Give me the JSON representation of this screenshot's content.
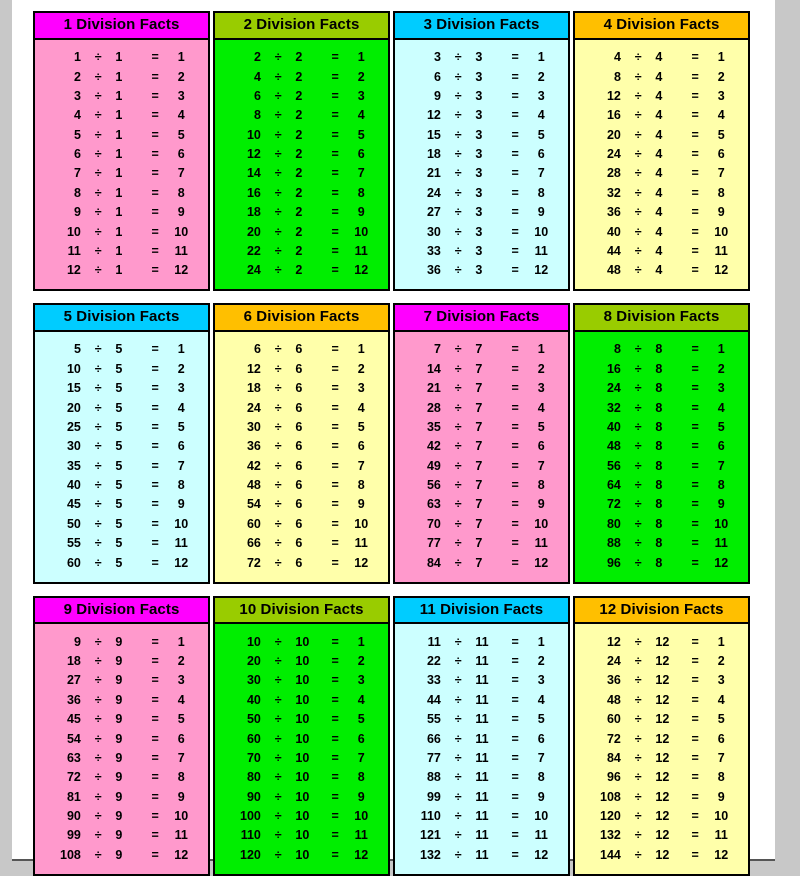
{
  "page": {
    "title": "Division Facts Tables",
    "background_color": "#ffffff",
    "outer_background_color": "#c8c8c8"
  },
  "palette": {
    "magenta_header": "#ff00ff",
    "pink_body": "#ff99cc",
    "olive_header": "#99cc00",
    "green_body": "#00ee00",
    "cyan_header": "#00ccff",
    "light_cyan_body": "#ccffff",
    "orange_header": "#ffbf00",
    "light_yellow_body": "#ffffaa",
    "border": "#000000",
    "text": "#000000"
  },
  "symbols": {
    "divide": "÷",
    "equals": "="
  },
  "cards": [
    {
      "title": "1 Division Facts",
      "header_color": "#ff00ff",
      "body_color": "#ff99cc",
      "header_class": "hdr-magenta",
      "body_class": "bdy-pink",
      "rows": [
        {
          "dividend": "1",
          "divisor": "1",
          "quotient": "1"
        },
        {
          "dividend": "2",
          "divisor": "1",
          "quotient": "2"
        },
        {
          "dividend": "3",
          "divisor": "1",
          "quotient": "3"
        },
        {
          "dividend": "4",
          "divisor": "1",
          "quotient": "4"
        },
        {
          "dividend": "5",
          "divisor": "1",
          "quotient": "5"
        },
        {
          "dividend": "6",
          "divisor": "1",
          "quotient": "6"
        },
        {
          "dividend": "7",
          "divisor": "1",
          "quotient": "7"
        },
        {
          "dividend": "8",
          "divisor": "1",
          "quotient": "8"
        },
        {
          "dividend": "9",
          "divisor": "1",
          "quotient": "9"
        },
        {
          "dividend": "10",
          "divisor": "1",
          "quotient": "10"
        },
        {
          "dividend": "11",
          "divisor": "1",
          "quotient": "11"
        },
        {
          "dividend": "12",
          "divisor": "1",
          "quotient": "12"
        }
      ]
    },
    {
      "title": "2 Division Facts",
      "header_color": "#99cc00",
      "body_color": "#00ee00",
      "header_class": "hdr-olive",
      "body_class": "bdy-green",
      "rows": [
        {
          "dividend": "2",
          "divisor": "2",
          "quotient": "1"
        },
        {
          "dividend": "4",
          "divisor": "2",
          "quotient": "2"
        },
        {
          "dividend": "6",
          "divisor": "2",
          "quotient": "3"
        },
        {
          "dividend": "8",
          "divisor": "2",
          "quotient": "4"
        },
        {
          "dividend": "10",
          "divisor": "2",
          "quotient": "5"
        },
        {
          "dividend": "12",
          "divisor": "2",
          "quotient": "6"
        },
        {
          "dividend": "14",
          "divisor": "2",
          "quotient": "7"
        },
        {
          "dividend": "16",
          "divisor": "2",
          "quotient": "8"
        },
        {
          "dividend": "18",
          "divisor": "2",
          "quotient": "9"
        },
        {
          "dividend": "20",
          "divisor": "2",
          "quotient": "10"
        },
        {
          "dividend": "22",
          "divisor": "2",
          "quotient": "11"
        },
        {
          "dividend": "24",
          "divisor": "2",
          "quotient": "12"
        }
      ]
    },
    {
      "title": "3 Division Facts",
      "header_color": "#00ccff",
      "body_color": "#ccffff",
      "header_class": "hdr-cyan",
      "body_class": "bdy-ltcyan",
      "rows": [
        {
          "dividend": "3",
          "divisor": "3",
          "quotient": "1"
        },
        {
          "dividend": "6",
          "divisor": "3",
          "quotient": "2"
        },
        {
          "dividend": "9",
          "divisor": "3",
          "quotient": "3"
        },
        {
          "dividend": "12",
          "divisor": "3",
          "quotient": "4"
        },
        {
          "dividend": "15",
          "divisor": "3",
          "quotient": "5"
        },
        {
          "dividend": "18",
          "divisor": "3",
          "quotient": "6"
        },
        {
          "dividend": "21",
          "divisor": "3",
          "quotient": "7"
        },
        {
          "dividend": "24",
          "divisor": "3",
          "quotient": "8"
        },
        {
          "dividend": "27",
          "divisor": "3",
          "quotient": "9"
        },
        {
          "dividend": "30",
          "divisor": "3",
          "quotient": "10"
        },
        {
          "dividend": "33",
          "divisor": "3",
          "quotient": "11"
        },
        {
          "dividend": "36",
          "divisor": "3",
          "quotient": "12"
        }
      ]
    },
    {
      "title": "4 Division Facts",
      "header_color": "#ffbf00",
      "body_color": "#ffffaa",
      "header_class": "hdr-orange",
      "body_class": "bdy-ltyellow",
      "rows": [
        {
          "dividend": "4",
          "divisor": "4",
          "quotient": "1"
        },
        {
          "dividend": "8",
          "divisor": "4",
          "quotient": "2"
        },
        {
          "dividend": "12",
          "divisor": "4",
          "quotient": "3"
        },
        {
          "dividend": "16",
          "divisor": "4",
          "quotient": "4"
        },
        {
          "dividend": "20",
          "divisor": "4",
          "quotient": "5"
        },
        {
          "dividend": "24",
          "divisor": "4",
          "quotient": "6"
        },
        {
          "dividend": "28",
          "divisor": "4",
          "quotient": "7"
        },
        {
          "dividend": "32",
          "divisor": "4",
          "quotient": "8"
        },
        {
          "dividend": "36",
          "divisor": "4",
          "quotient": "9"
        },
        {
          "dividend": "40",
          "divisor": "4",
          "quotient": "10"
        },
        {
          "dividend": "44",
          "divisor": "4",
          "quotient": "11"
        },
        {
          "dividend": "48",
          "divisor": "4",
          "quotient": "12"
        }
      ]
    },
    {
      "title": "5 Division Facts",
      "header_color": "#00ccff",
      "body_color": "#ccffff",
      "header_class": "hdr-cyan",
      "body_class": "bdy-ltcyan",
      "rows": [
        {
          "dividend": "5",
          "divisor": "5",
          "quotient": "1"
        },
        {
          "dividend": "10",
          "divisor": "5",
          "quotient": "2"
        },
        {
          "dividend": "15",
          "divisor": "5",
          "quotient": "3"
        },
        {
          "dividend": "20",
          "divisor": "5",
          "quotient": "4"
        },
        {
          "dividend": "25",
          "divisor": "5",
          "quotient": "5"
        },
        {
          "dividend": "30",
          "divisor": "5",
          "quotient": "6"
        },
        {
          "dividend": "35",
          "divisor": "5",
          "quotient": "7"
        },
        {
          "dividend": "40",
          "divisor": "5",
          "quotient": "8"
        },
        {
          "dividend": "45",
          "divisor": "5",
          "quotient": "9"
        },
        {
          "dividend": "50",
          "divisor": "5",
          "quotient": "10"
        },
        {
          "dividend": "55",
          "divisor": "5",
          "quotient": "11"
        },
        {
          "dividend": "60",
          "divisor": "5",
          "quotient": "12"
        }
      ]
    },
    {
      "title": "6 Division Facts",
      "header_color": "#ffbf00",
      "body_color": "#ffffaa",
      "header_class": "hdr-orange",
      "body_class": "bdy-ltyellow",
      "rows": [
        {
          "dividend": "6",
          "divisor": "6",
          "quotient": "1"
        },
        {
          "dividend": "12",
          "divisor": "6",
          "quotient": "2"
        },
        {
          "dividend": "18",
          "divisor": "6",
          "quotient": "3"
        },
        {
          "dividend": "24",
          "divisor": "6",
          "quotient": "4"
        },
        {
          "dividend": "30",
          "divisor": "6",
          "quotient": "5"
        },
        {
          "dividend": "36",
          "divisor": "6",
          "quotient": "6"
        },
        {
          "dividend": "42",
          "divisor": "6",
          "quotient": "7"
        },
        {
          "dividend": "48",
          "divisor": "6",
          "quotient": "8"
        },
        {
          "dividend": "54",
          "divisor": "6",
          "quotient": "9"
        },
        {
          "dividend": "60",
          "divisor": "6",
          "quotient": "10"
        },
        {
          "dividend": "66",
          "divisor": "6",
          "quotient": "11"
        },
        {
          "dividend": "72",
          "divisor": "6",
          "quotient": "12"
        }
      ]
    },
    {
      "title": "7 Division Facts",
      "header_color": "#ff00ff",
      "body_color": "#ff99cc",
      "header_class": "hdr-magenta",
      "body_class": "bdy-pink",
      "rows": [
        {
          "dividend": "7",
          "divisor": "7",
          "quotient": "1"
        },
        {
          "dividend": "14",
          "divisor": "7",
          "quotient": "2"
        },
        {
          "dividend": "21",
          "divisor": "7",
          "quotient": "3"
        },
        {
          "dividend": "28",
          "divisor": "7",
          "quotient": "4"
        },
        {
          "dividend": "35",
          "divisor": "7",
          "quotient": "5"
        },
        {
          "dividend": "42",
          "divisor": "7",
          "quotient": "6"
        },
        {
          "dividend": "49",
          "divisor": "7",
          "quotient": "7"
        },
        {
          "dividend": "56",
          "divisor": "7",
          "quotient": "8"
        },
        {
          "dividend": "63",
          "divisor": "7",
          "quotient": "9"
        },
        {
          "dividend": "70",
          "divisor": "7",
          "quotient": "10"
        },
        {
          "dividend": "77",
          "divisor": "7",
          "quotient": "11"
        },
        {
          "dividend": "84",
          "divisor": "7",
          "quotient": "12"
        }
      ]
    },
    {
      "title": "8 Division Facts",
      "header_color": "#99cc00",
      "body_color": "#00ee00",
      "header_class": "hdr-olive",
      "body_class": "bdy-green",
      "rows": [
        {
          "dividend": "8",
          "divisor": "8",
          "quotient": "1"
        },
        {
          "dividend": "16",
          "divisor": "8",
          "quotient": "2"
        },
        {
          "dividend": "24",
          "divisor": "8",
          "quotient": "3"
        },
        {
          "dividend": "32",
          "divisor": "8",
          "quotient": "4"
        },
        {
          "dividend": "40",
          "divisor": "8",
          "quotient": "5"
        },
        {
          "dividend": "48",
          "divisor": "8",
          "quotient": "6"
        },
        {
          "dividend": "56",
          "divisor": "8",
          "quotient": "7"
        },
        {
          "dividend": "64",
          "divisor": "8",
          "quotient": "8"
        },
        {
          "dividend": "72",
          "divisor": "8",
          "quotient": "9"
        },
        {
          "dividend": "80",
          "divisor": "8",
          "quotient": "10"
        },
        {
          "dividend": "88",
          "divisor": "8",
          "quotient": "11"
        },
        {
          "dividend": "96",
          "divisor": "8",
          "quotient": "12"
        }
      ]
    },
    {
      "title": "9 Division Facts",
      "header_color": "#ff00ff",
      "body_color": "#ff99cc",
      "header_class": "hdr-magenta",
      "body_class": "bdy-pink",
      "rows": [
        {
          "dividend": "9",
          "divisor": "9",
          "quotient": "1"
        },
        {
          "dividend": "18",
          "divisor": "9",
          "quotient": "2"
        },
        {
          "dividend": "27",
          "divisor": "9",
          "quotient": "3"
        },
        {
          "dividend": "36",
          "divisor": "9",
          "quotient": "4"
        },
        {
          "dividend": "45",
          "divisor": "9",
          "quotient": "5"
        },
        {
          "dividend": "54",
          "divisor": "9",
          "quotient": "6"
        },
        {
          "dividend": "63",
          "divisor": "9",
          "quotient": "7"
        },
        {
          "dividend": "72",
          "divisor": "9",
          "quotient": "8"
        },
        {
          "dividend": "81",
          "divisor": "9",
          "quotient": "9"
        },
        {
          "dividend": "90",
          "divisor": "9",
          "quotient": "10"
        },
        {
          "dividend": "99",
          "divisor": "9",
          "quotient": "11"
        },
        {
          "dividend": "108",
          "divisor": "9",
          "quotient": "12"
        }
      ]
    },
    {
      "title": "10 Division Facts",
      "header_color": "#99cc00",
      "body_color": "#00ee00",
      "header_class": "hdr-olive",
      "body_class": "bdy-green",
      "rows": [
        {
          "dividend": "10",
          "divisor": "10",
          "quotient": "1"
        },
        {
          "dividend": "20",
          "divisor": "10",
          "quotient": "2"
        },
        {
          "dividend": "30",
          "divisor": "10",
          "quotient": "3"
        },
        {
          "dividend": "40",
          "divisor": "10",
          "quotient": "4"
        },
        {
          "dividend": "50",
          "divisor": "10",
          "quotient": "5"
        },
        {
          "dividend": "60",
          "divisor": "10",
          "quotient": "6"
        },
        {
          "dividend": "70",
          "divisor": "10",
          "quotient": "7"
        },
        {
          "dividend": "80",
          "divisor": "10",
          "quotient": "8"
        },
        {
          "dividend": "90",
          "divisor": "10",
          "quotient": "9"
        },
        {
          "dividend": "100",
          "divisor": "10",
          "quotient": "10"
        },
        {
          "dividend": "110",
          "divisor": "10",
          "quotient": "11"
        },
        {
          "dividend": "120",
          "divisor": "10",
          "quotient": "12"
        }
      ]
    },
    {
      "title": "11 Division Facts",
      "header_color": "#00ccff",
      "body_color": "#ccffff",
      "header_class": "hdr-cyan",
      "body_class": "bdy-ltcyan",
      "rows": [
        {
          "dividend": "11",
          "divisor": "11",
          "quotient": "1"
        },
        {
          "dividend": "22",
          "divisor": "11",
          "quotient": "2"
        },
        {
          "dividend": "33",
          "divisor": "11",
          "quotient": "3"
        },
        {
          "dividend": "44",
          "divisor": "11",
          "quotient": "4"
        },
        {
          "dividend": "55",
          "divisor": "11",
          "quotient": "5"
        },
        {
          "dividend": "66",
          "divisor": "11",
          "quotient": "6"
        },
        {
          "dividend": "77",
          "divisor": "11",
          "quotient": "7"
        },
        {
          "dividend": "88",
          "divisor": "11",
          "quotient": "8"
        },
        {
          "dividend": "99",
          "divisor": "11",
          "quotient": "9"
        },
        {
          "dividend": "110",
          "divisor": "11",
          "quotient": "10"
        },
        {
          "dividend": "121",
          "divisor": "11",
          "quotient": "11"
        },
        {
          "dividend": "132",
          "divisor": "11",
          "quotient": "12"
        }
      ]
    },
    {
      "title": "12 Division Facts",
      "header_color": "#ffbf00",
      "body_color": "#ffffaa",
      "header_class": "hdr-orange",
      "body_class": "bdy-ltyellow",
      "rows": [
        {
          "dividend": "12",
          "divisor": "12",
          "quotient": "1"
        },
        {
          "dividend": "24",
          "divisor": "12",
          "quotient": "2"
        },
        {
          "dividend": "36",
          "divisor": "12",
          "quotient": "3"
        },
        {
          "dividend": "48",
          "divisor": "12",
          "quotient": "4"
        },
        {
          "dividend": "60",
          "divisor": "12",
          "quotient": "5"
        },
        {
          "dividend": "72",
          "divisor": "12",
          "quotient": "6"
        },
        {
          "dividend": "84",
          "divisor": "12",
          "quotient": "7"
        },
        {
          "dividend": "96",
          "divisor": "12",
          "quotient": "8"
        },
        {
          "dividend": "108",
          "divisor": "12",
          "quotient": "9"
        },
        {
          "dividend": "120",
          "divisor": "12",
          "quotient": "10"
        },
        {
          "dividend": "132",
          "divisor": "12",
          "quotient": "11"
        },
        {
          "dividend": "144",
          "divisor": "12",
          "quotient": "12"
        }
      ]
    }
  ]
}
